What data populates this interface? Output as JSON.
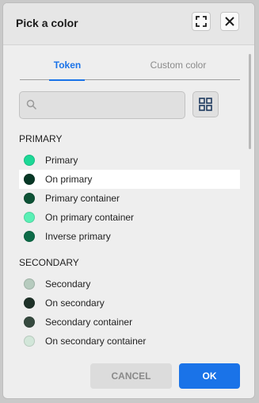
{
  "dialog": {
    "title": "Pick a color",
    "expand_icon": "expand-icon",
    "close_icon": "close-icon"
  },
  "tabs": [
    {
      "label": "Token",
      "active": true
    },
    {
      "label": "Custom color",
      "active": false
    }
  ],
  "search": {
    "placeholder": "",
    "value": "",
    "icon": "search-icon"
  },
  "view_toggle_icon": "grid-icon",
  "sections": [
    {
      "label": "PRIMARY",
      "items": [
        {
          "label": "Primary",
          "color": "#1cd896"
        },
        {
          "label": "On primary",
          "color": "#073826",
          "selected": true
        },
        {
          "label": "Primary container",
          "color": "#0d5236"
        },
        {
          "label": "On primary container",
          "color": "#5af0b5"
        },
        {
          "label": "Inverse primary",
          "color": "#0d6b48"
        }
      ]
    },
    {
      "label": "SECONDARY",
      "items": [
        {
          "label": "Secondary",
          "color": "#b6cbbe"
        },
        {
          "label": "On secondary",
          "color": "#1e3128"
        },
        {
          "label": "Secondary container",
          "color": "#364a3f"
        },
        {
          "label": "On secondary container",
          "color": "#d2e6d9"
        }
      ]
    }
  ],
  "footer": {
    "cancel_label": "CANCEL",
    "ok_label": "OK"
  },
  "colors": {
    "accent": "#1a73e8",
    "selected_row": "#ffffff"
  }
}
